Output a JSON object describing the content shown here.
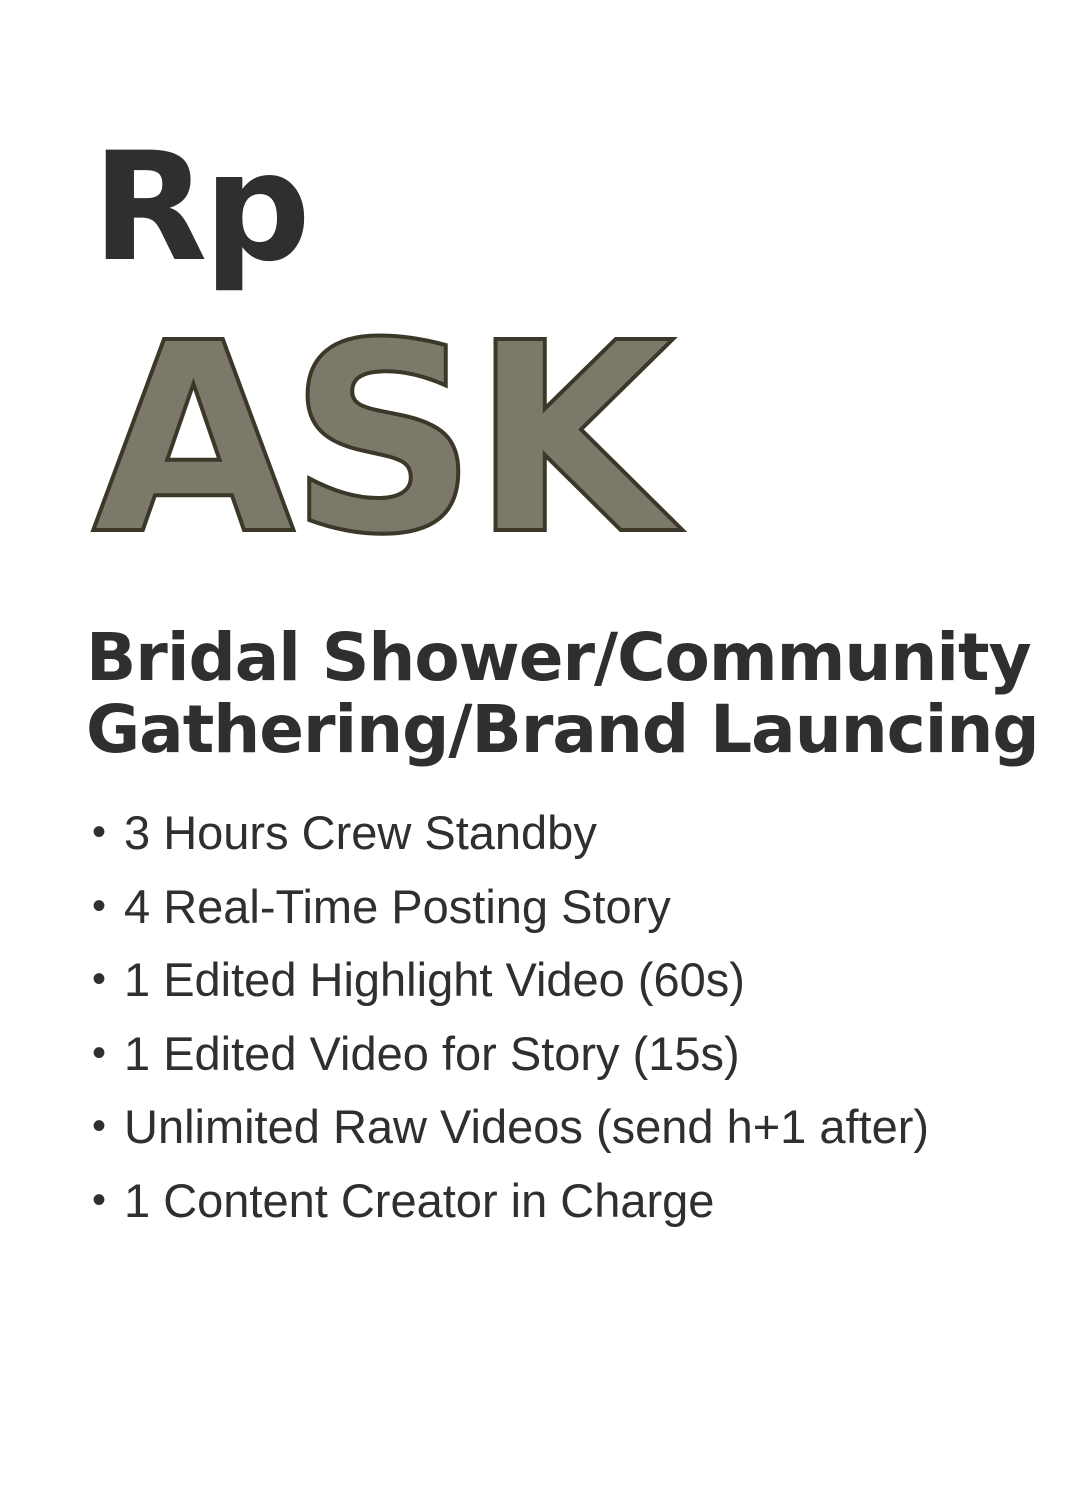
{
  "pricing_card": {
    "currency": "Rp",
    "price": "ASK",
    "title_lines": [
      "Bridal Shower/Community",
      "Gathering/Brand Launcing"
    ],
    "bullet_char": "•",
    "features": [
      "3 Hours Crew Standby",
      "4 Real-Time Posting Story",
      "1 Edited Highlight Video (60s)",
      "1 Edited Video for Story (15s)",
      "Unlimited Raw Videos (send h+1 after)",
      "1 Content Creator in Charge"
    ],
    "colors": {
      "text": "#2f2f2f",
      "price_fill": "#7d796a",
      "price_outline": "#3b3829",
      "background": "#ffffff"
    }
  }
}
